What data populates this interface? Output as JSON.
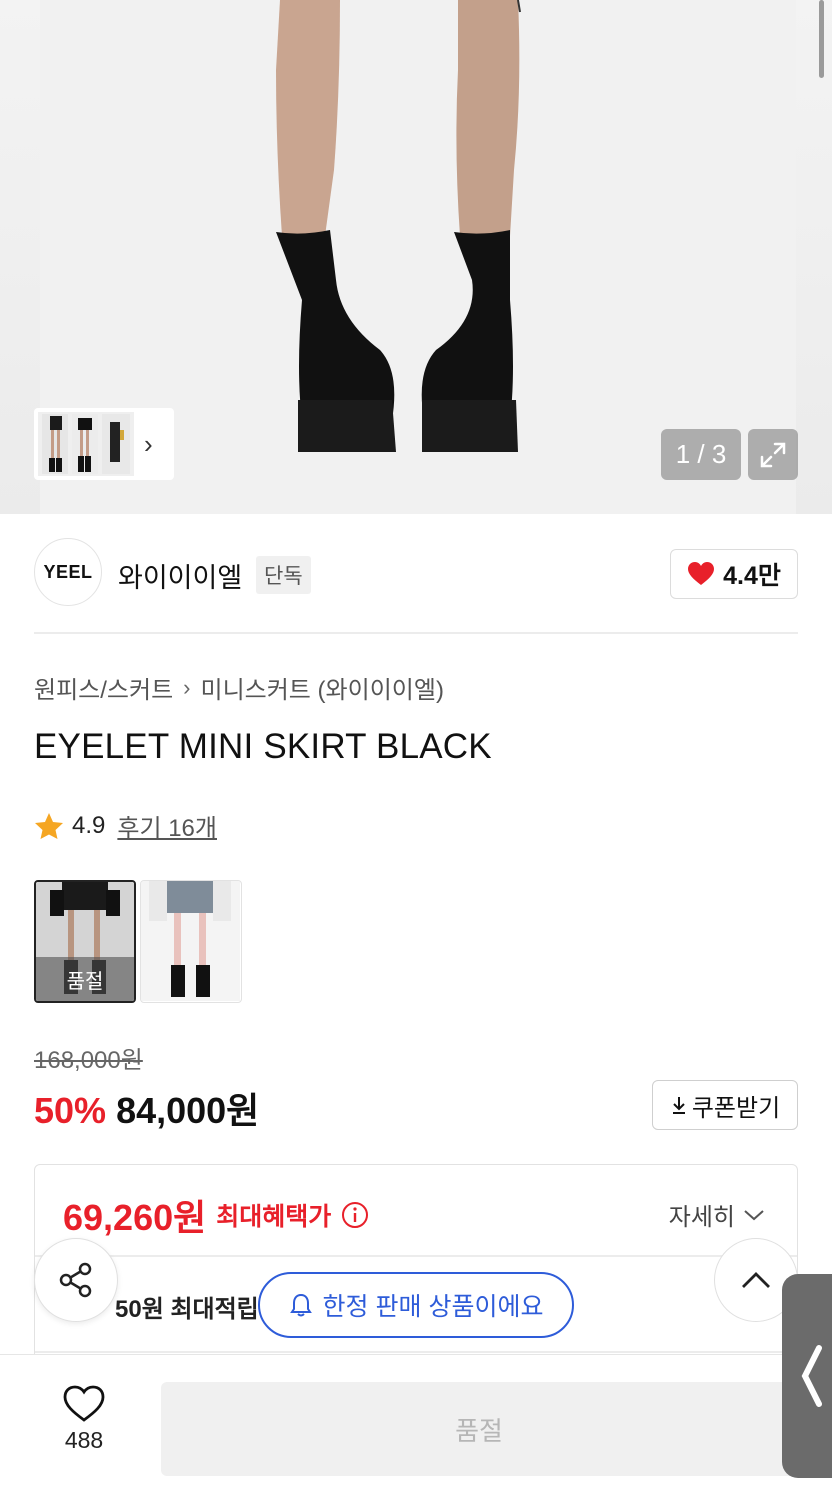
{
  "hero": {
    "counter": "1 / 3",
    "thumb_chevron": "›"
  },
  "brand": {
    "logo_text": "YEEL",
    "name": "와이이이엘",
    "badge": "단독",
    "likes": "4.4만"
  },
  "breadcrumb": {
    "category": "원피스/스커트",
    "separator": "›",
    "subcategory": "미니스커트 (와이이이엘)"
  },
  "product": {
    "title": "EYELET MINI SKIRT BLACK",
    "rating": "4.9",
    "reviews": "후기 16개",
    "swatch_soldout_label": "품절"
  },
  "price": {
    "original": "168,000원",
    "discount": "50%",
    "sale": "84,000원",
    "coupon_label": "쿠폰받기"
  },
  "benefit": {
    "max_price": "69,260원",
    "max_label": "최대혜택가",
    "detail_label": "자세히",
    "points_text": "50원 최대적립"
  },
  "toast": {
    "text": "한정 판매 상품이에요"
  },
  "bottom": {
    "wish_count": "488",
    "buy_label": "품절"
  },
  "colors": {
    "sale_red": "#e8202a",
    "toast_blue": "#2e5cd9",
    "heart_red": "#e8202a"
  }
}
